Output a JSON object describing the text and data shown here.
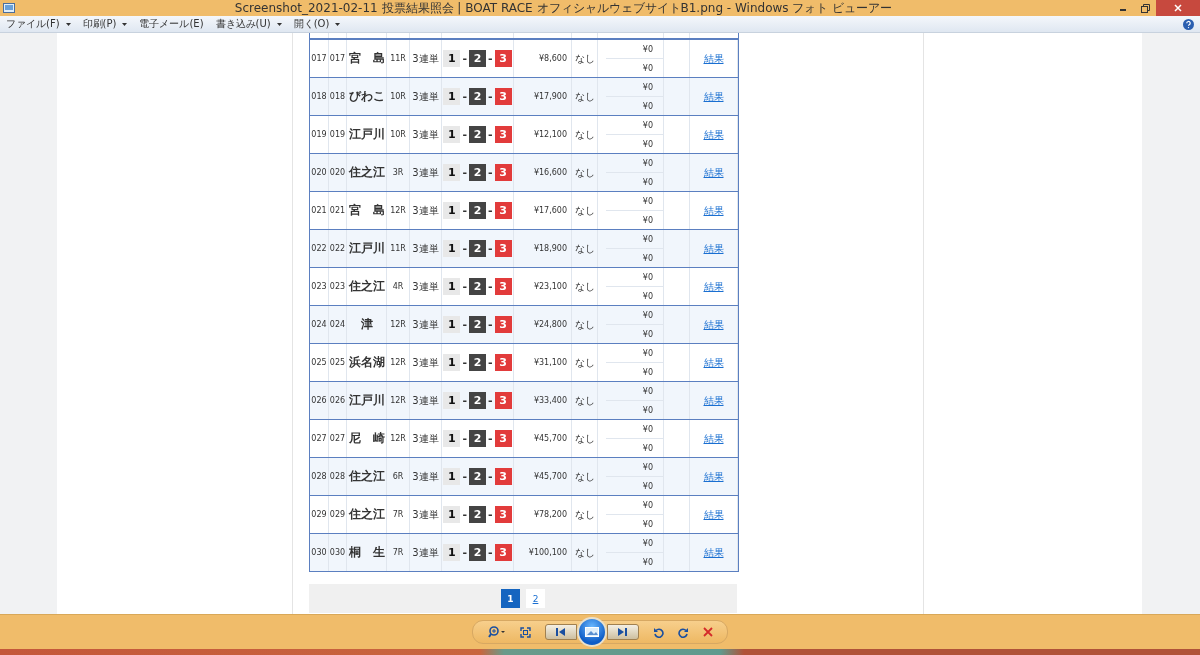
{
  "window": {
    "title": "Screenshot_2021-02-11 投票結果照会 | BOAT RACE オフィシャルウェブサイトB1.png - Windows フォト ビューアー"
  },
  "menu": [
    {
      "label": "ファイル(F)",
      "has_menu": true
    },
    {
      "label": "印刷(P)",
      "has_menu": true
    },
    {
      "label": "電子メール(E)",
      "has_menu": false
    },
    {
      "label": "書き込み(U)",
      "has_menu": true
    },
    {
      "label": "開く(O)",
      "has_menu": true
    }
  ],
  "table": {
    "rows": [
      {
        "no": "017",
        "no2": "017",
        "venue": "宮　島",
        "race": "11R",
        "bet": "3連単",
        "combo": [
          "1",
          "-",
          "2",
          "-",
          "3"
        ],
        "payout": "¥8,600",
        "note": "なし",
        "amounts": [
          "¥0",
          "¥0"
        ],
        "link": "結果"
      },
      {
        "no": "018",
        "no2": "018",
        "venue": "びわこ",
        "race": "10R",
        "bet": "3連単",
        "combo": [
          "1",
          "-",
          "2",
          "-",
          "3"
        ],
        "payout": "¥17,900",
        "note": "なし",
        "amounts": [
          "¥0",
          "¥0"
        ],
        "link": "結果"
      },
      {
        "no": "019",
        "no2": "019",
        "venue": "江戸川",
        "race": "10R",
        "bet": "3連単",
        "combo": [
          "1",
          "-",
          "2",
          "-",
          "3"
        ],
        "payout": "¥12,100",
        "note": "なし",
        "amounts": [
          "¥0",
          "¥0"
        ],
        "link": "結果"
      },
      {
        "no": "020",
        "no2": "020",
        "venue": "住之江",
        "race": "3R",
        "bet": "3連単",
        "combo": [
          "1",
          "-",
          "2",
          "-",
          "3"
        ],
        "payout": "¥16,600",
        "note": "なし",
        "amounts": [
          "¥0",
          "¥0"
        ],
        "link": "結果"
      },
      {
        "no": "021",
        "no2": "021",
        "venue": "宮　島",
        "race": "12R",
        "bet": "3連単",
        "combo": [
          "1",
          "-",
          "2",
          "-",
          "3"
        ],
        "payout": "¥17,600",
        "note": "なし",
        "amounts": [
          "¥0",
          "¥0"
        ],
        "link": "結果"
      },
      {
        "no": "022",
        "no2": "022",
        "venue": "江戸川",
        "race": "11R",
        "bet": "3連単",
        "combo": [
          "1",
          "-",
          "2",
          "-",
          "3"
        ],
        "payout": "¥18,900",
        "note": "なし",
        "amounts": [
          "¥0",
          "¥0"
        ],
        "link": "結果"
      },
      {
        "no": "023",
        "no2": "023",
        "venue": "住之江",
        "race": "4R",
        "bet": "3連単",
        "combo": [
          "1",
          "-",
          "2",
          "-",
          "3"
        ],
        "payout": "¥23,100",
        "note": "なし",
        "amounts": [
          "¥0",
          "¥0"
        ],
        "link": "結果"
      },
      {
        "no": "024",
        "no2": "024",
        "venue": "津",
        "race": "12R",
        "bet": "3連単",
        "combo": [
          "1",
          "-",
          "2",
          "-",
          "3"
        ],
        "payout": "¥24,800",
        "note": "なし",
        "amounts": [
          "¥0",
          "¥0"
        ],
        "link": "結果"
      },
      {
        "no": "025",
        "no2": "025",
        "venue": "浜名湖",
        "race": "12R",
        "bet": "3連単",
        "combo": [
          "1",
          "-",
          "2",
          "-",
          "3"
        ],
        "payout": "¥31,100",
        "note": "なし",
        "amounts": [
          "¥0",
          "¥0"
        ],
        "link": "結果"
      },
      {
        "no": "026",
        "no2": "026",
        "venue": "江戸川",
        "race": "12R",
        "bet": "3連単",
        "combo": [
          "1",
          "-",
          "2",
          "-",
          "3"
        ],
        "payout": "¥33,400",
        "note": "なし",
        "amounts": [
          "¥0",
          "¥0"
        ],
        "link": "結果"
      },
      {
        "no": "027",
        "no2": "027",
        "venue": "尼　崎",
        "race": "12R",
        "bet": "3連単",
        "combo": [
          "1",
          "-",
          "2",
          "-",
          "3"
        ],
        "payout": "¥45,700",
        "note": "なし",
        "amounts": [
          "¥0",
          "¥0"
        ],
        "link": "結果"
      },
      {
        "no": "028",
        "no2": "028",
        "venue": "住之江",
        "race": "6R",
        "bet": "3連単",
        "combo": [
          "1",
          "-",
          "2",
          "-",
          "3"
        ],
        "payout": "¥45,700",
        "note": "なし",
        "amounts": [
          "¥0",
          "¥0"
        ],
        "link": "結果"
      },
      {
        "no": "029",
        "no2": "029",
        "venue": "住之江",
        "race": "7R",
        "bet": "3連単",
        "combo": [
          "1",
          "-",
          "2",
          "-",
          "3"
        ],
        "payout": "¥78,200",
        "note": "なし",
        "amounts": [
          "¥0",
          "¥0"
        ],
        "link": "結果"
      },
      {
        "no": "030",
        "no2": "030",
        "venue": "桐　生",
        "race": "7R",
        "bet": "3連単",
        "combo": [
          "1",
          "-",
          "2",
          "-",
          "3"
        ],
        "payout": "¥100,100",
        "note": "なし",
        "amounts": [
          "¥0",
          "¥0"
        ],
        "link": "結果"
      }
    ]
  },
  "pagination": [
    {
      "label": "1",
      "selected": true
    },
    {
      "label": "2",
      "selected": false
    }
  ]
}
